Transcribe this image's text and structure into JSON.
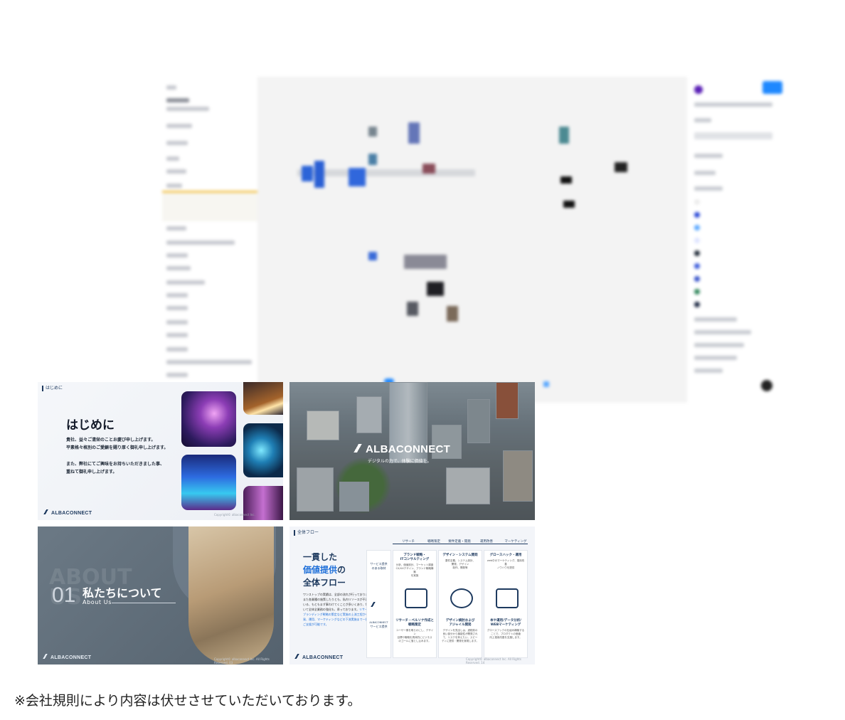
{
  "slides": {
    "intro": {
      "tag": "はじめに",
      "heading": "はじめに",
      "lines": [
        "貴社、益々ご清栄のことお慶び申し上げます。",
        "平素格々格別のご愛顧を賜り厚く御礼申し上げます。",
        "また、弊社にてご興味をお持ちいただきました事、",
        "重ねて御礼申し上げます。"
      ],
      "logo": "ALBACONNECT",
      "copyright": "Copyright© albaconnect Inc."
    },
    "cover": {
      "logo": "ALBACONNECT",
      "tagline": "デジタルの力で、体験に価値を。"
    },
    "about": {
      "number": "01",
      "title": "私たちについて",
      "subtitle": "About Us",
      "ghost": "ABOUT US",
      "logo": "ALBACONNECT",
      "copyright": "Copyright© albaconnect Inc. All Rights Reserved. 03"
    },
    "flow": {
      "tag": "全体フロー",
      "title_line1": "一貫した",
      "title_line2_a": "価値提供",
      "title_line2_b": "の",
      "title_line3": "全体フロー",
      "para": "ワンストップの実績は、全部の流れが行っております。また各業種の施策したりとも、私内リソースが不足している、もともまず事わけてくことが多いくあり、切り合いて全体全業務の強化も、承っております。",
      "para_hl": "リサーチ、ブランディング戦略の策定など実施の上流工程から、開発、運用、マーケティングなどの下流実施まで一貫したご支援が可能です。",
      "phases": [
        "リサーチ",
        "戦略策定",
        "要件定義・開発",
        "運用改善",
        "マーケティング"
      ],
      "side_top": "サービス提供\nのある取材",
      "side_logo": "ALBACONNECT",
      "side_bottom": "サービス提供",
      "columns": [
        {
          "head": "ブランド戦略・\nITコンサルティング",
          "text": "分析、価値設計、マーケット調査\nCX/UXデザイン、ブランド戦略構築\nを実施",
          "foot": "リサーチ・ペルソナ作成と\n戦略策定",
          "foot_text": "ユーザー像を明らかにし、デザイン\n目標や戦略を具体的に\nビジネス"
        },
        {
          "head": "デザイン・システム開発",
          "text": "要件定義、システム設計、\n開発、デザイン\n制作、開発等"
        },
        {
          "head": "グロースハック・運用",
          "text": "web中のマーケティング、運用改善\nノウハウを提供"
        }
      ],
      "col_foot": [
        {
          "title": "リサーチ・ペルソナ作成と\n戦略策定",
          "text": "ユーザー像を明らかにし、デザイン\n目標や戦略を具体的にビジネス\nのゴールに落とし込みます。"
        },
        {
          "title": "デザイン検討および\nアジャイル開発",
          "text": "デザインを見出しは、過程前の\n良い部分から機能性が開発され\nて、リスクを抑えたい。スピー\nディに提供・開発を実現します。"
        },
        {
          "title": "本や運用/データ分析/\nWEBマーケティング",
          "text": "グロースフックの仕組み構築する\nことで、プロダクトの価値\n向上運用改善を支援します。"
        }
      ],
      "logo": "ALBACONNECT",
      "copyright": "Copyright© albaconnect Inc. All Rights Reserved. 14"
    }
  },
  "note": "※会社規則により内容は伏せさせていただいております。",
  "colors": {
    "navy": "#1e3a5f",
    "accent": "#1e6fd9",
    "figma_blue": "#1e88ff"
  }
}
